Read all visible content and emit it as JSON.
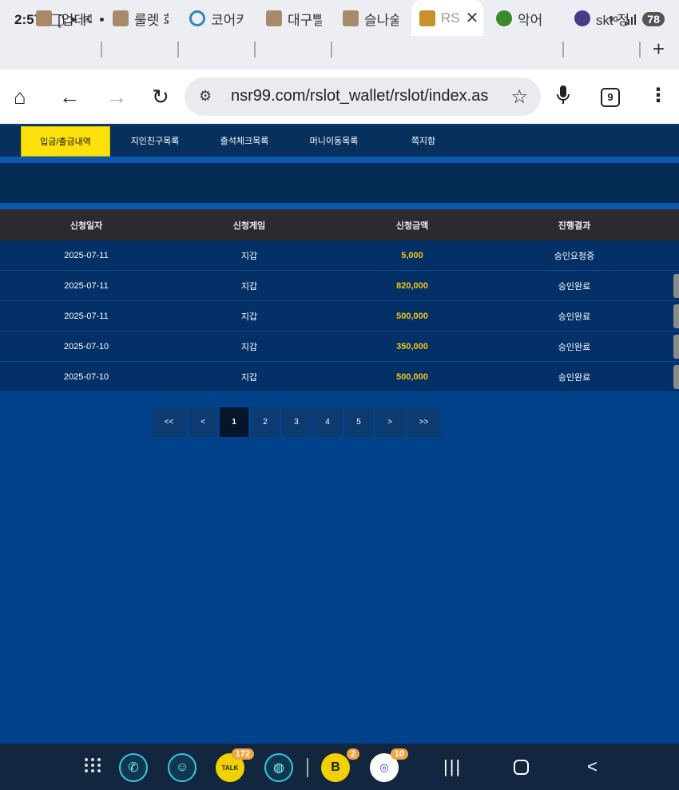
{
  "status_bar": {
    "time": "2:57",
    "network": "5G",
    "battery": "78"
  },
  "browser": {
    "tabs": [
      {
        "label": "[업데이",
        "favicon_color": "#a78a6a"
      },
      {
        "label": "룰렛 회",
        "favicon_color": "#a78a6a"
      },
      {
        "label": "코어키",
        "favicon_color": "#2a8ab8"
      },
      {
        "label": "대구빨",
        "favicon_color": "#a78a6a"
      },
      {
        "label": "슬나술",
        "favicon_color": "#a78a6a"
      },
      {
        "label": "RS",
        "favicon_color": "#c8912a"
      },
      {
        "label": "악어",
        "favicon_color": "#3a8a2a"
      },
      {
        "label": "skt 정",
        "favicon_color": "#4a3a8a"
      }
    ],
    "url": "nsr99.com/rslot_wallet/rslot/index.as",
    "tab_count": "9"
  },
  "page": {
    "menu": [
      "입금/출금내역",
      "지인친구목록",
      "출석체크목록",
      "머니이동목록",
      "쪽지함"
    ],
    "table": {
      "headers": [
        "신청일자",
        "신청게임",
        "신청금액",
        "진행결과"
      ],
      "rows": [
        {
          "date": "2025-07-11",
          "game": "지갑",
          "amount": "5,000",
          "status": "승인요청중"
        },
        {
          "date": "2025-07-11",
          "game": "지갑",
          "amount": "820,000",
          "status": "승인완료"
        },
        {
          "date": "2025-07-11",
          "game": "지갑",
          "amount": "500,000",
          "status": "승인완료"
        },
        {
          "date": "2025-07-10",
          "game": "지갑",
          "amount": "350,000",
          "status": "승인완료"
        },
        {
          "date": "2025-07-10",
          "game": "지갑",
          "amount": "500,000",
          "status": "승인완료"
        }
      ]
    },
    "pagination": {
      "first": "<<",
      "prev": "<",
      "pages": [
        "1",
        "2",
        "3",
        "4",
        "5"
      ],
      "current": "1",
      "next": ">",
      "last": ">>"
    }
  },
  "bottom_nav": {
    "badges": {
      "talk": "172",
      "b_app": "2",
      "coin_app": "10"
    },
    "talk_label": "TALK",
    "b_label": "B"
  }
}
